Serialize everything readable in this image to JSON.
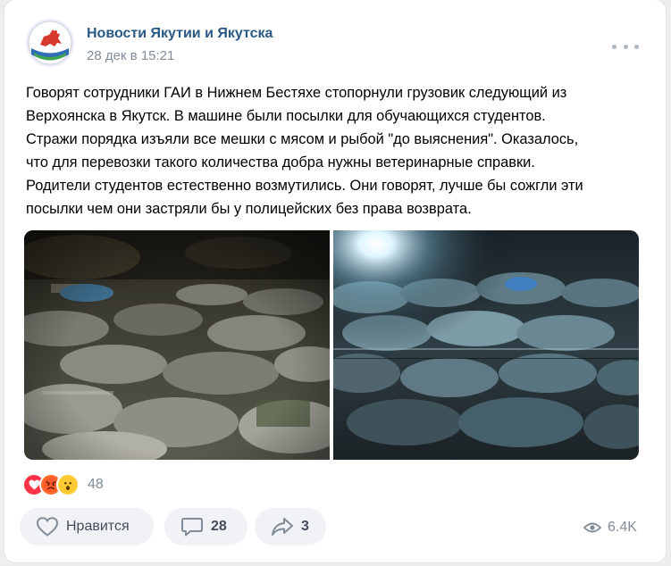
{
  "post": {
    "author": "Новости Якутии и Якутска",
    "date": "28 дек в 15:21",
    "text_lines": [
      "Говорят сотрудники ГАИ в Нижнем Бестяхе стопорнули грузовик следующий из",
      "Верхоянска в Якутск. В машине были посылки для обучающихся студентов.",
      "Стражи порядка изъяли все мешки с мясом и рыбой \"до выяснения\". Оказалось,",
      "что для перевозки такого количества добра нужны ветеринарные справки.",
      "Родители студентов естественно возмутились. Они говорят, лучше бы сожгли эти",
      "посылки чем они застряли бы у полицейских без права возврата."
    ],
    "photos": [
      {
        "name": "photo-bags-dark"
      },
      {
        "name": "photo-bags-flash"
      }
    ]
  },
  "reactions": {
    "icons": [
      "heart-icon",
      "angry-face-icon",
      "shocked-face-icon"
    ],
    "count": "48"
  },
  "actions": {
    "like_label": "Нравится",
    "comments_count": "28",
    "shares_count": "3",
    "views": "6.4K"
  },
  "colors": {
    "author": "#2a5885",
    "secondary": "#818c99",
    "button_bg": "#f0f2f5",
    "heart": "#ff3347"
  }
}
